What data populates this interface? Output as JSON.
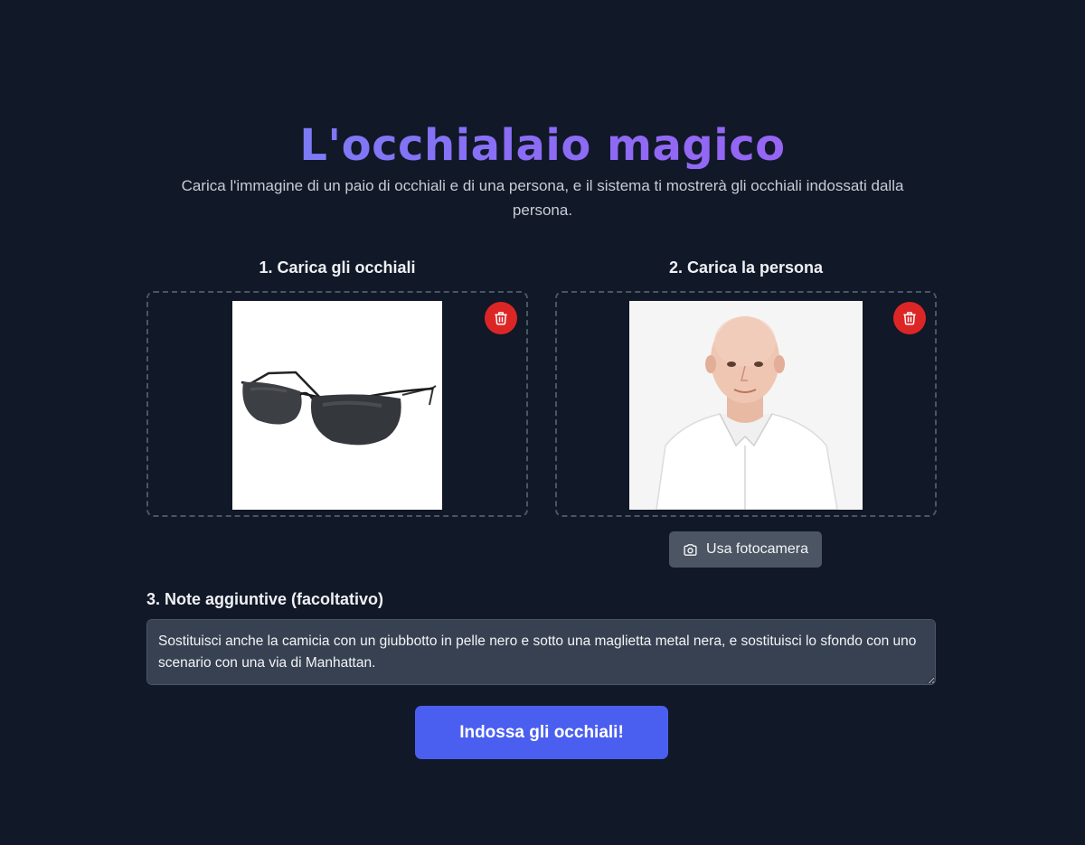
{
  "header": {
    "title": "L'occhialaio magico",
    "subtitle": "Carica l'immagine di un paio di occhiali e di una persona, e il sistema ti mostrerà gli occhiali indossati dalla persona."
  },
  "glasses_section": {
    "heading": "1. Carica gli occhiali",
    "delete_icon": "trash-icon"
  },
  "person_section": {
    "heading": "2. Carica la persona",
    "delete_icon": "trash-icon",
    "camera_icon": "camera-icon",
    "camera_button_label": "Usa fotocamera"
  },
  "notes": {
    "label": "3. Note aggiuntive (facoltativo)",
    "value": "Sostituisci anche la camicia con un giubbotto in pelle nero e sotto una maglietta metal nera, e sostituisci lo sfondo con uno scenario con una via di Manhattan."
  },
  "submit": {
    "label": "Indossa gli occhiali!"
  },
  "colors": {
    "background": "#111827",
    "accent": "#4a5ff0",
    "delete": "#dc2626"
  }
}
